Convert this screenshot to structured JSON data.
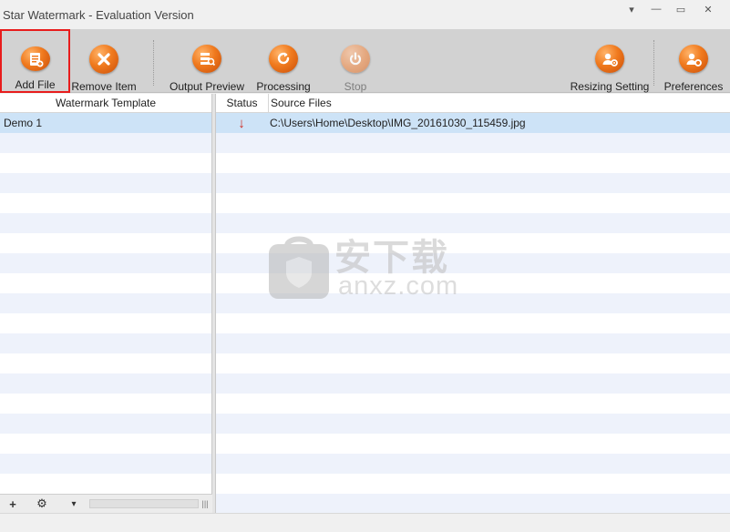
{
  "window": {
    "title": "Star Watermark - Evaluation Version",
    "controls": {
      "menu": "▾",
      "minimize": "—",
      "maximize": "▭",
      "close": "✕"
    }
  },
  "toolbar": {
    "buttons": [
      {
        "label": "Add File",
        "icon": "add-file-icon",
        "selected": true
      },
      {
        "label": "Remove Item",
        "icon": "remove-item-icon"
      },
      {
        "label": "Output Preview",
        "icon": "output-preview-icon"
      },
      {
        "label": "Processing",
        "icon": "processing-icon"
      },
      {
        "label": "Stop",
        "icon": "stop-icon",
        "disabled": true
      },
      {
        "label": "Resizing Setting",
        "icon": "resizing-setting-icon"
      },
      {
        "label": "Preferences",
        "icon": "preferences-icon"
      }
    ]
  },
  "templates": {
    "header": "Watermark Template",
    "items": [
      "Demo 1"
    ]
  },
  "files": {
    "headers": {
      "status": "Status",
      "source": "Source Files"
    },
    "rows": [
      {
        "status": "↓",
        "status_icon": "pending-down-arrow-icon",
        "path": "C:\\Users\\Home\\Desktop\\IMG_20161030_115459.jpg"
      }
    ]
  },
  "left_footer": {
    "add": "+",
    "settings": "⚙",
    "dropdown": "▾",
    "grip": "|||"
  },
  "watermark_overlay": {
    "chinese_text": "安下载",
    "domain_text": "anxz.com",
    "logo_char": "安"
  },
  "colors": {
    "toolbar_bg": "#d2d2d2",
    "accent_orange": "#f07a1e",
    "selected_row": "#cde3f7",
    "alt_row": "#eef2fb",
    "selection_outline": "#e81c1c",
    "status_arrow": "#d0261a"
  }
}
